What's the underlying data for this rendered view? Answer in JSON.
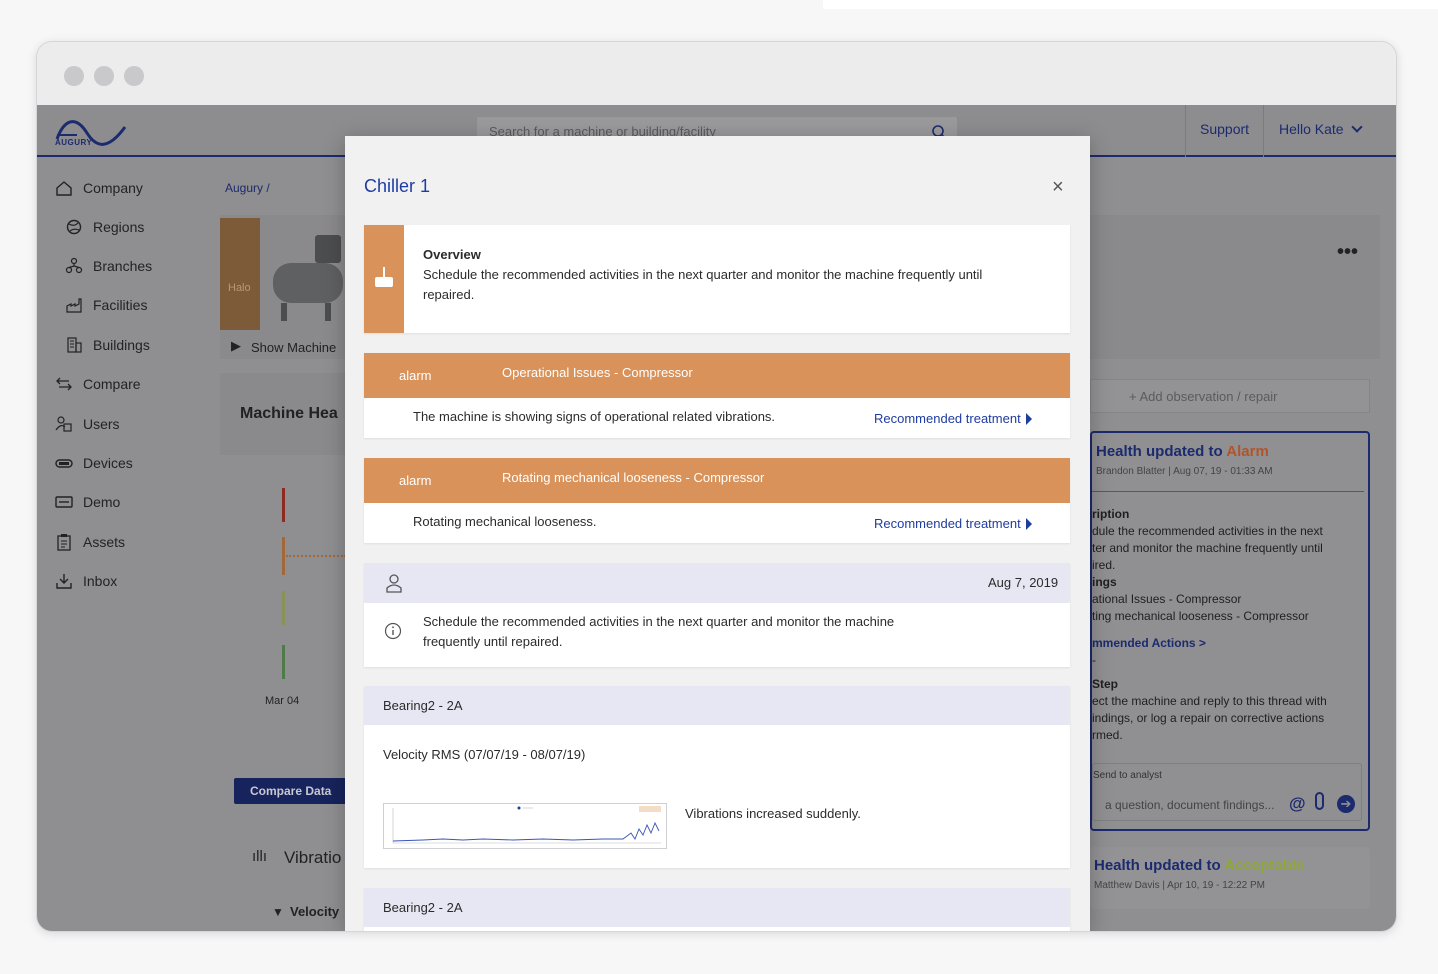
{
  "app": {
    "brand": "AUGURY",
    "search_placeholder": "Search for a machine or building/facility",
    "support": "Support",
    "greeting": "Hello Kate"
  },
  "sidebar": {
    "items": [
      {
        "label": "Company",
        "icon": "home-icon"
      },
      {
        "label": "Regions",
        "icon": "globe-icon"
      },
      {
        "label": "Branches",
        "icon": "branches-icon"
      },
      {
        "label": "Facilities",
        "icon": "factory-icon"
      },
      {
        "label": "Buildings",
        "icon": "building-icon"
      },
      {
        "label": "Compare",
        "icon": "compare-icon"
      },
      {
        "label": "Users",
        "icon": "users-icon"
      },
      {
        "label": "Devices",
        "icon": "device-icon"
      },
      {
        "label": "Demo",
        "icon": "demo-icon"
      },
      {
        "label": "Assets",
        "icon": "clipboard-icon"
      },
      {
        "label": "Inbox",
        "icon": "inbox-icon"
      }
    ]
  },
  "background": {
    "breadcrumb": "Augury /",
    "halo": "Halo",
    "show_machine": "Show Machine",
    "machine_health": "Machine Hea",
    "chart_tick": "Mar 04",
    "compare_btn": "Compare Data",
    "vibration": "Vibratio",
    "velocity": "Velocity",
    "add_observation": "+   Add observation / repair",
    "right_card": {
      "title_prefix": "Health updated to ",
      "title_status": "Alarm",
      "meta": "Brandon Blatter | Aug 07, 19 - 01:33 AM",
      "lines": [
        "ription",
        "dule the recommended activities in the next",
        "ter and monitor the machine frequently until",
        "ired.",
        "ings",
        "ational Issues - Compressor",
        "ting mechanical looseness - Compressor",
        "mmended Actions >",
        "-",
        " Step",
        "ect the machine and reply to this thread with",
        "indings, or log a repair on corrective actions",
        "rmed."
      ],
      "send_label": "Send to analyst",
      "input_ph": "a question, document findings..."
    },
    "card2": {
      "title_prefix": "Health updated to ",
      "title_status": "Acceptable",
      "meta": "Matthew Davis | Apr 10, 19 - 12:22 PM"
    }
  },
  "modal": {
    "title": "Chiller 1",
    "close": "×",
    "overview": {
      "heading": "Overview",
      "text_line1": "Schedule the recommended activities in the next quarter and monitor the machine frequently until",
      "text_line2": "repaired."
    },
    "alarms": [
      {
        "severity": "alarm",
        "title": "Operational Issues - Compressor",
        "description": "The machine is showing signs of operational related vibrations.",
        "link": "Recommended treatment"
      },
      {
        "severity": "alarm",
        "title": "Rotating mechanical looseness - Compressor",
        "description": "Rotating mechanical looseness.",
        "link": "Recommended treatment"
      }
    ],
    "note": {
      "date": "Aug 7, 2019",
      "text_line1": "Schedule the recommended activities in the next quarter and monitor the machine",
      "text_line2": "frequently until repaired."
    },
    "bearing1": {
      "name": "Bearing2 - 2A",
      "metric": "Velocity RMS (07/07/19 - 08/07/19)",
      "observation": "Vibrations increased suddenly."
    },
    "bearing2": {
      "name": "Bearing2 - 2A"
    }
  },
  "colors": {
    "accent": "#1f3ca1",
    "alarm": "#d8925a",
    "navy": "#1c2a6e",
    "acceptable": "#8fa83a"
  }
}
